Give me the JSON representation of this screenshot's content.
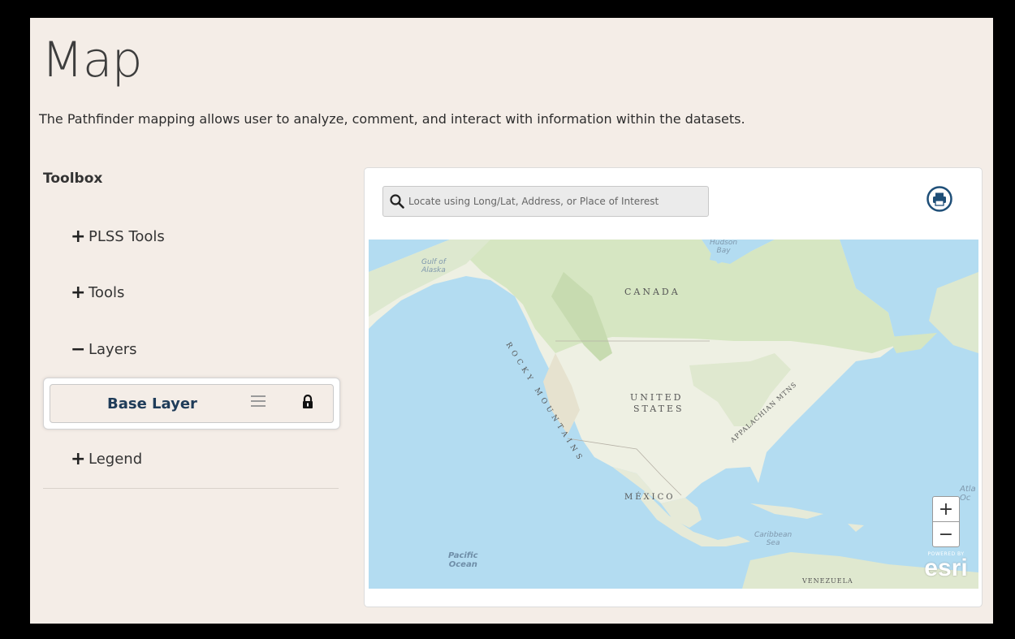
{
  "page": {
    "title": "Map",
    "description": "The Pathfinder mapping allows user to analyze, comment, and interact with information within the datasets."
  },
  "toolbox": {
    "title": "Toolbox",
    "items": [
      {
        "sign": "+",
        "label": "PLSS Tools"
      },
      {
        "sign": "+",
        "label": "Tools"
      },
      {
        "sign": "−",
        "label": "Layers"
      },
      {
        "sign": "+",
        "label": "Legend"
      }
    ],
    "layers": [
      {
        "name": "Base Layer",
        "drag_icon": "drag-handle-icon",
        "lock_icon": "lock-icon"
      }
    ]
  },
  "map": {
    "search_placeholder": "Locate using Long/Lat, Address, or Place of Interest",
    "print_icon": "print-icon",
    "labels": {
      "canada": "CANADA",
      "united_states_1": "UNITED",
      "united_states_2": "STATES",
      "mexico": "MÉXICO",
      "rocky_mountains": "ROCKY MOUNTAINS",
      "appalachian": "APPALACHIAN MTNS",
      "gulf_alaska_1": "Gulf of",
      "gulf_alaska_2": "Alaska",
      "hudson_1": "Hudson",
      "hudson_2": "Bay",
      "pacific_1": "Pacific",
      "pacific_2": "Ocean",
      "caribbean_1": "Caribbean",
      "caribbean_2": "Sea",
      "atlantic_1": "Atla",
      "atlantic_2": "Oc",
      "venezuela": "VENEZUELA"
    },
    "zoom_in": "+",
    "zoom_out": "−",
    "attribution_powered": "POWERED BY",
    "attribution_logo": "esri"
  },
  "colors": {
    "background": "#f4ede7",
    "layer_text": "#1f3c59",
    "print_icon": "#1f4f78",
    "water": "#b3dcf1",
    "land": "#eef0e3",
    "forest": "#d6e6c2"
  }
}
